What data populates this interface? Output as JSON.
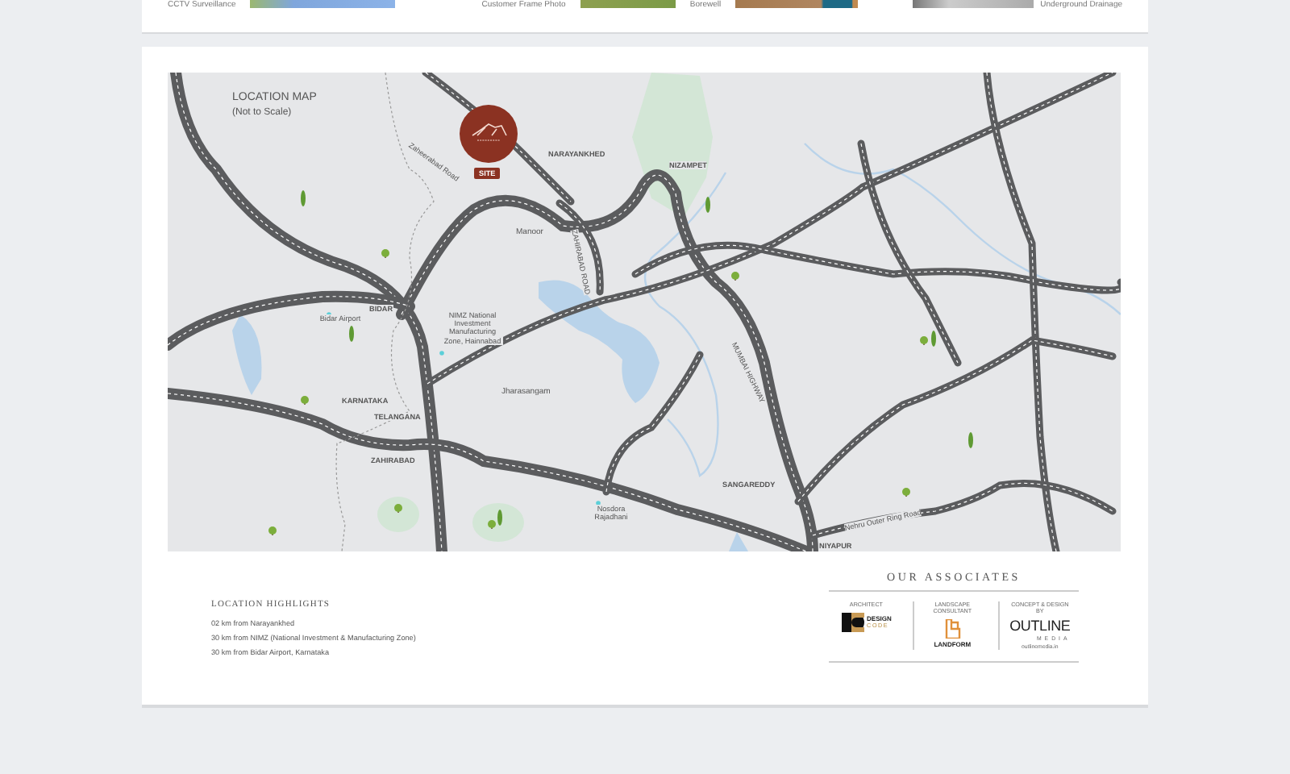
{
  "gallery": [
    {
      "caption": "CCTV Surveillance",
      "kind": "sky"
    },
    {
      "caption": "Customer Frame Photo",
      "kind": "grass"
    },
    {
      "caption": "Borewell",
      "kind": "soil"
    },
    {
      "caption": "Underground Drainage",
      "kind": "pipe"
    }
  ],
  "map": {
    "title": "LOCATION MAP",
    "subtitle": "(Not to Scale)",
    "site_label": "SITE",
    "places": [
      {
        "name": "NARAYANKHED",
        "kind": "town"
      },
      {
        "name": "NIZAMPET",
        "kind": "town"
      },
      {
        "name": "Manoor",
        "kind": "area"
      },
      {
        "name": "Zaheerabad Road",
        "kind": "road"
      },
      {
        "name": "ZAHIRABAD ROAD",
        "kind": "road"
      },
      {
        "name": "BIDAR",
        "kind": "town"
      },
      {
        "name": "Bidar Airport",
        "kind": "landmark"
      },
      {
        "name": "NIMZ National Investment Manufacturing Zone, Hainnabad",
        "kind": "landmark"
      },
      {
        "name": "Jharasangam",
        "kind": "area"
      },
      {
        "name": "KARNATAKA",
        "kind": "town"
      },
      {
        "name": "TELANGANA",
        "kind": "town"
      },
      {
        "name": "ZAHIRABAD",
        "kind": "town"
      },
      {
        "name": "Nosdora Rajadhani",
        "kind": "landmark"
      },
      {
        "name": "SANGAREDDY",
        "kind": "town"
      },
      {
        "name": "MUMBAI HIGHWAY",
        "kind": "road"
      },
      {
        "name": "Nehru Outer Ring Road",
        "kind": "road"
      },
      {
        "name": "NIYAPUR",
        "kind": "town"
      }
    ]
  },
  "highlights": {
    "title": "LOCATION HIGHLIGHTS",
    "items": [
      "02 km from Narayankhed",
      "30 km from NIMZ (National Investment & Manufacturing Zone)",
      "30 km from Bidar Airport, Karnataka"
    ]
  },
  "associates": {
    "title": "OUR ASSOCIATES",
    "items": [
      {
        "role": "ARCHITECT",
        "kind": "design",
        "name": "DESIGN",
        "sub": "CODE"
      },
      {
        "role": "LANDSCAPE CONSULTANT",
        "kind": "landform",
        "name": "LANDFORM"
      },
      {
        "role": "CONCEPT & DESIGN BY",
        "kind": "outline",
        "name": "OUTLINE",
        "sub": "MEDIA",
        "site": "outlinemedia.in"
      }
    ]
  }
}
